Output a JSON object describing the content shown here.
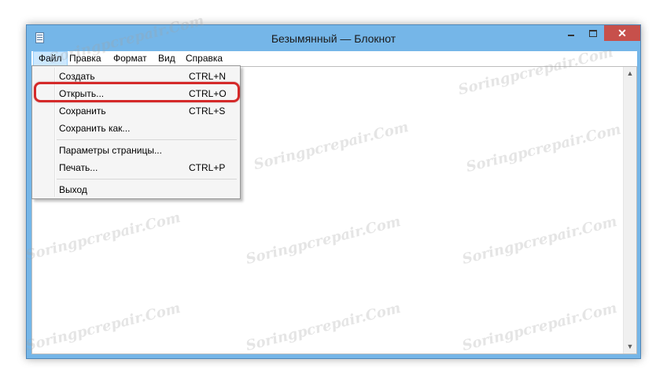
{
  "window": {
    "title": "Безымянный — Блокнот",
    "close_glyph": "✕"
  },
  "menubar": {
    "items": [
      "Файл",
      "Правка",
      "Формат",
      "Вид",
      "Справка"
    ]
  },
  "file_menu": {
    "items": [
      {
        "label": "Создать",
        "shortcut": "CTRL+N"
      },
      {
        "label": "Открыть...",
        "shortcut": "CTRL+O"
      },
      {
        "label": "Сохранить",
        "shortcut": "CTRL+S"
      },
      {
        "label": "Сохранить как...",
        "shortcut": ""
      },
      {
        "label": "Параметры страницы...",
        "shortcut": ""
      },
      {
        "label": "Печать...",
        "shortcut": "CTRL+P"
      },
      {
        "label": "Выход",
        "shortcut": ""
      }
    ]
  },
  "scrollbar": {
    "up_glyph": "▲",
    "down_glyph": "▼"
  },
  "watermark": {
    "text": "Soringpcrepair.Com"
  },
  "colors": {
    "titlebar": "#75b6e8",
    "close_button": "#c7504b",
    "highlight": "#d42a2a",
    "menu_active": "#cce8ff"
  }
}
